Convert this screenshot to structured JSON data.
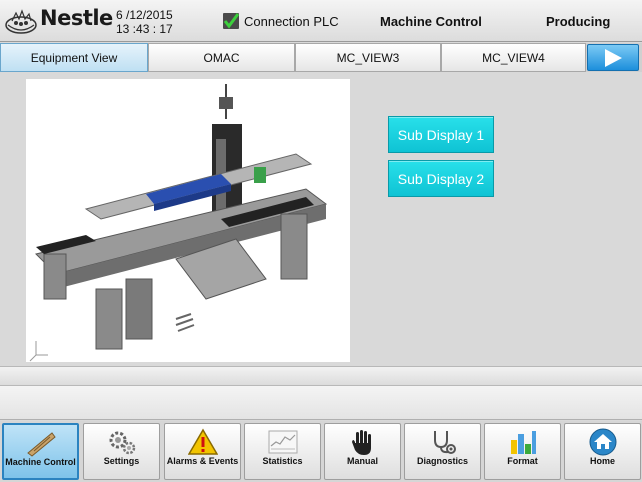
{
  "header": {
    "logo_text": "Nestle",
    "date": "6 /12/2015",
    "time": "13 :43 : 17",
    "connection_label": "Connection PLC",
    "title": "Machine Control",
    "status": "Producing"
  },
  "tabs": [
    {
      "label": "Equipment View",
      "active": true
    },
    {
      "label": "OMAC",
      "active": false
    },
    {
      "label": "MC_VIEW3",
      "active": false
    },
    {
      "label": "MC_VIEW4",
      "active": false
    }
  ],
  "main": {
    "sub_display_1": "Sub Display 1",
    "sub_display_2": "Sub Display 2"
  },
  "nav": [
    {
      "label": "Machine Control",
      "icon": "machine-control-icon",
      "active": true
    },
    {
      "label": "Settings",
      "icon": "gears-icon",
      "active": false
    },
    {
      "label": "Alarms & Events",
      "icon": "warning-icon",
      "active": false
    },
    {
      "label": "Statistics",
      "icon": "chart-icon",
      "active": false
    },
    {
      "label": "Manual",
      "icon": "hand-icon",
      "active": false
    },
    {
      "label": "Diagnostics",
      "icon": "stethoscope-icon",
      "active": false
    },
    {
      "label": "Format",
      "icon": "bar-chart-icon",
      "active": false
    },
    {
      "label": "Home",
      "icon": "home-icon",
      "active": false
    }
  ],
  "colors": {
    "accent_cyan": "#1bd0de",
    "tab_next_blue": "#1d8fdc",
    "connection_green": "#2e9e2e"
  }
}
